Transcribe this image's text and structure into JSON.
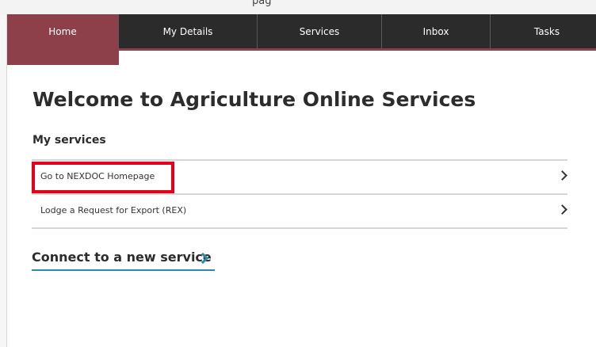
{
  "top_strip": {
    "text": "pag"
  },
  "nav": {
    "tabs": [
      {
        "label": "Home",
        "active": true
      },
      {
        "label": "My Details",
        "active": false
      },
      {
        "label": "Services",
        "active": false
      },
      {
        "label": "Inbox",
        "active": false
      },
      {
        "label": "Tasks",
        "active": false
      }
    ],
    "accent_color": "#8d3f4a",
    "bar_color": "#2b2b2b"
  },
  "main": {
    "title": "Welcome to Agriculture Online Services",
    "section_heading": "My services",
    "services": [
      {
        "label": "Go to NEXDOC Homepage",
        "icon": "chevron-right-icon",
        "highlighted": true
      },
      {
        "label": "Lodge a Request for Export (REX)",
        "icon": "chevron-right-icon",
        "highlighted": false
      }
    ],
    "connect_link": {
      "label": "Connect to a new service",
      "icon": "chevron-right-icon",
      "color": "#2b8aa6"
    },
    "highlight_color": "#e3001b"
  }
}
